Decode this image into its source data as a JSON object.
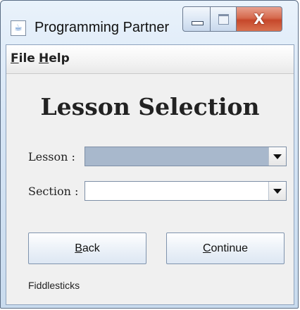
{
  "window": {
    "title": "Programming Partner",
    "close_symbol": "X",
    "icons": {
      "app": "java-cup-icon",
      "minimize": "minimize-icon",
      "maximize": "maximize-icon",
      "close": "close-icon"
    }
  },
  "menu": {
    "file": {
      "mnemonic": "F",
      "rest": "ile"
    },
    "help": {
      "mnemonic": "H",
      "rest": "elp"
    }
  },
  "heading": "Lesson Selection",
  "lesson": {
    "label": "Lesson :",
    "value": ""
  },
  "section": {
    "label": "Section :",
    "value": ""
  },
  "buttons": {
    "back": {
      "mnemonic": "B",
      "rest": "ack"
    },
    "continue": {
      "mnemonic": "C",
      "rest": "ontinue"
    }
  },
  "status": "Fiddlesticks",
  "colors": {
    "selected_combo": "#a8b8cc",
    "panel": "#f0f0f0",
    "close_button": "#c6482b"
  }
}
